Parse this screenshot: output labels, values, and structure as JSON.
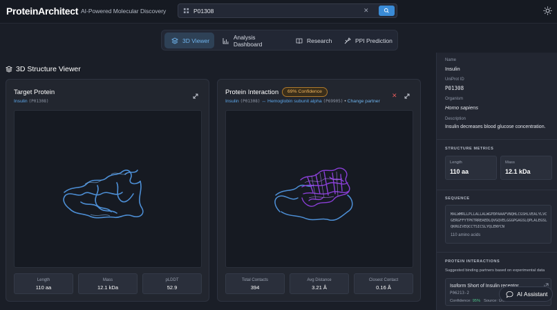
{
  "app": {
    "name": "ProteinArchitect",
    "tagline": "AI-Powered Molecular Discovery"
  },
  "search": {
    "value": "P01308"
  },
  "nav": {
    "tabs": [
      {
        "label": "3D Viewer",
        "icon": "cube-icon",
        "active": true
      },
      {
        "label": "Analysis Dashboard",
        "icon": "bar-chart-icon",
        "active": false
      },
      {
        "label": "Research",
        "icon": "book-icon",
        "active": false
      },
      {
        "label": "PPI Prediction",
        "icon": "ppi-icon",
        "active": false
      }
    ]
  },
  "section_title": "3D Structure Viewer",
  "target_card": {
    "title": "Target Protein",
    "protein_name": "Insulin",
    "protein_id": "(P01308)",
    "ribbon_color": "#4d8fd6",
    "stats": [
      {
        "label": "Length",
        "value": "110 aa"
      },
      {
        "label": "Mass",
        "value": "12.1 kDa"
      },
      {
        "label": "pLDDT",
        "value": "52.9"
      }
    ]
  },
  "interaction_card": {
    "title": "Protein Interaction",
    "confidence": "69% Confidence",
    "protein_a": "Insulin",
    "protein_a_id": "(P01308)",
    "arrow": "↔",
    "protein_b": "Hemoglobin subunit alpha",
    "protein_b_id": "(P69905)",
    "separator": "•",
    "change_partner": "Change partner",
    "partner_color": "#8b3fd9",
    "stats": [
      {
        "label": "Total Contacts",
        "value": "394"
      },
      {
        "label": "Avg Distance",
        "value": "3.21 Å"
      },
      {
        "label": "Closest Contact",
        "value": "0.16 Å"
      }
    ]
  },
  "info_panel": {
    "name_label": "Name",
    "name": "Insulin",
    "uniprot_label": "UniProt ID",
    "uniprot": "P01308",
    "organism_label": "Organism",
    "organism": "Homo sapiens",
    "description_label": "Description",
    "description": "Insulin decreases blood glucose concentration.",
    "metrics_title": "STRUCTURE METRICS",
    "metrics": [
      {
        "label": "Length",
        "value": "110 aa"
      },
      {
        "label": "Mass",
        "value": "12.1 kDa"
      }
    ],
    "sequence_title": "SEQUENCE",
    "sequence": "MALWMRLLPLLALLALWGPDPAAAFVNQHLCGSHLVEALYLVCGERGFFYTPKTRREAEDLQVGQVELGGGPGAGSLQPLALEGSLQKRGIVEQCCTSICSLYQLENYCN",
    "sequence_count": "110 amino acids",
    "interactions_title": "PROTEIN INTERACTIONS",
    "interactions_note": "Suggested binding partners based on experimental data",
    "partner": {
      "name": "Isoform Short of Insulin receptor",
      "id": "P06213-2",
      "confidence_label": "Confidence:",
      "confidence": "95%",
      "source_label": "Source:",
      "source": "UniProt"
    }
  },
  "ai_button": "AI Assistant"
}
